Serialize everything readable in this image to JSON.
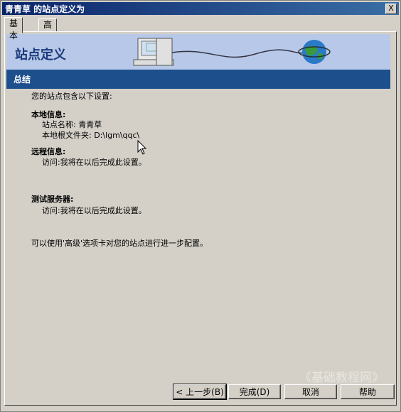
{
  "window": {
    "title": "青青草 的站点定义为",
    "close_label": "X"
  },
  "tabs": [
    {
      "label": "基本"
    },
    {
      "label": "高级"
    }
  ],
  "banner": {
    "title": "站点定义"
  },
  "section": {
    "title": "总结"
  },
  "summary": {
    "intro": "您的站点包含以下设置:",
    "local_heading": "本地信息:",
    "site_name": "站点名称: 青青草",
    "root_folder": "本地根文件夹: D:\\lgm\\qqc\\",
    "remote_heading": "远程信息:",
    "remote_access": "访问:我将在以后完成此设置。",
    "testing_heading": "测试服务器:",
    "testing_access": "访问:我将在以后完成此设置。",
    "advanced_note": "可以使用'高级'选项卡对您的站点进行进一步配置。"
  },
  "buttons": {
    "back": "< 上一步(B)",
    "finish": "完成(D)",
    "cancel": "取消",
    "help": "帮助"
  },
  "watermark": "《基础教程网》",
  "icons": [
    "computer-icon",
    "globe-icon",
    "mouse-cursor-icon"
  ]
}
